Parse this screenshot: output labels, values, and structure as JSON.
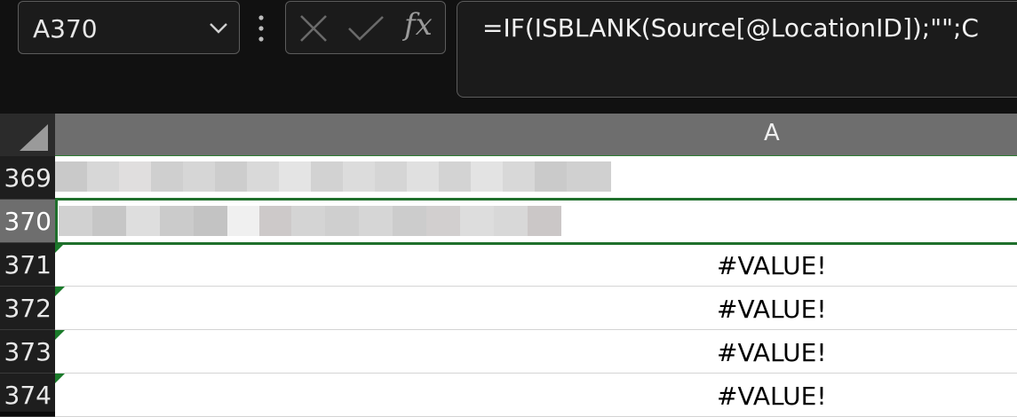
{
  "name_box": {
    "value": "A370",
    "chevron": "chevron-down-icon"
  },
  "formula_bar": {
    "more_icon": "vertical-ellipsis-icon",
    "cancel_icon": "close-icon",
    "enter_icon": "checkmark-icon",
    "fx_label": "fx",
    "formula": "=IF(ISBLANK(Source[@LocationID]);\"\";C"
  },
  "grid": {
    "column_header": "A",
    "rows": [
      {
        "number": "369",
        "value": "",
        "error_flag": false
      },
      {
        "number": "370",
        "value": "",
        "error_flag": false,
        "selected": true
      },
      {
        "number": "371",
        "value": "#VALUE!",
        "error_flag": true
      },
      {
        "number": "372",
        "value": "#VALUE!",
        "error_flag": true
      },
      {
        "number": "373",
        "value": "#VALUE!",
        "error_flag": true
      },
      {
        "number": "374",
        "value": "#VALUE!",
        "error_flag": true
      }
    ]
  },
  "colors": {
    "accent_green": "#1f6f2c",
    "header_gray": "#6e6e6e"
  }
}
